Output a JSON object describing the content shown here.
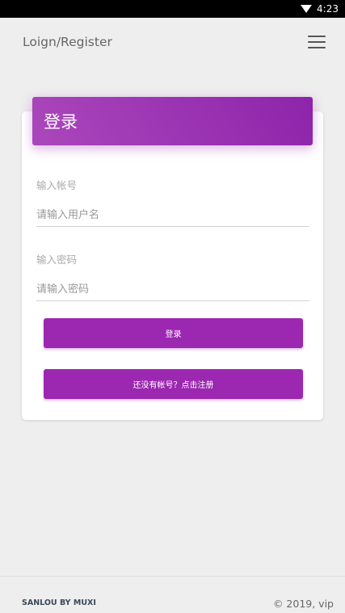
{
  "status_bar": {
    "time": "4:23"
  },
  "app_bar": {
    "title": "Loign/Register"
  },
  "login_card": {
    "title": "登录",
    "account": {
      "label": "输入帐号",
      "placeholder": "请输入用户名"
    },
    "password": {
      "label": "输入密码",
      "placeholder": "请输入密码"
    },
    "login_button": "登录",
    "register_button": "还没有帐号？点击注册"
  },
  "footer": {
    "left": "SANLOU BY MUXI",
    "right": "© 2019, vip"
  },
  "colors": {
    "accent": "#9c27b0",
    "header_gradient_start": "#ab47bc",
    "header_gradient_end": "#8e24aa"
  },
  "icons": {
    "status_wifi": "wifi-icon",
    "menu": "hamburger-menu-icon"
  }
}
